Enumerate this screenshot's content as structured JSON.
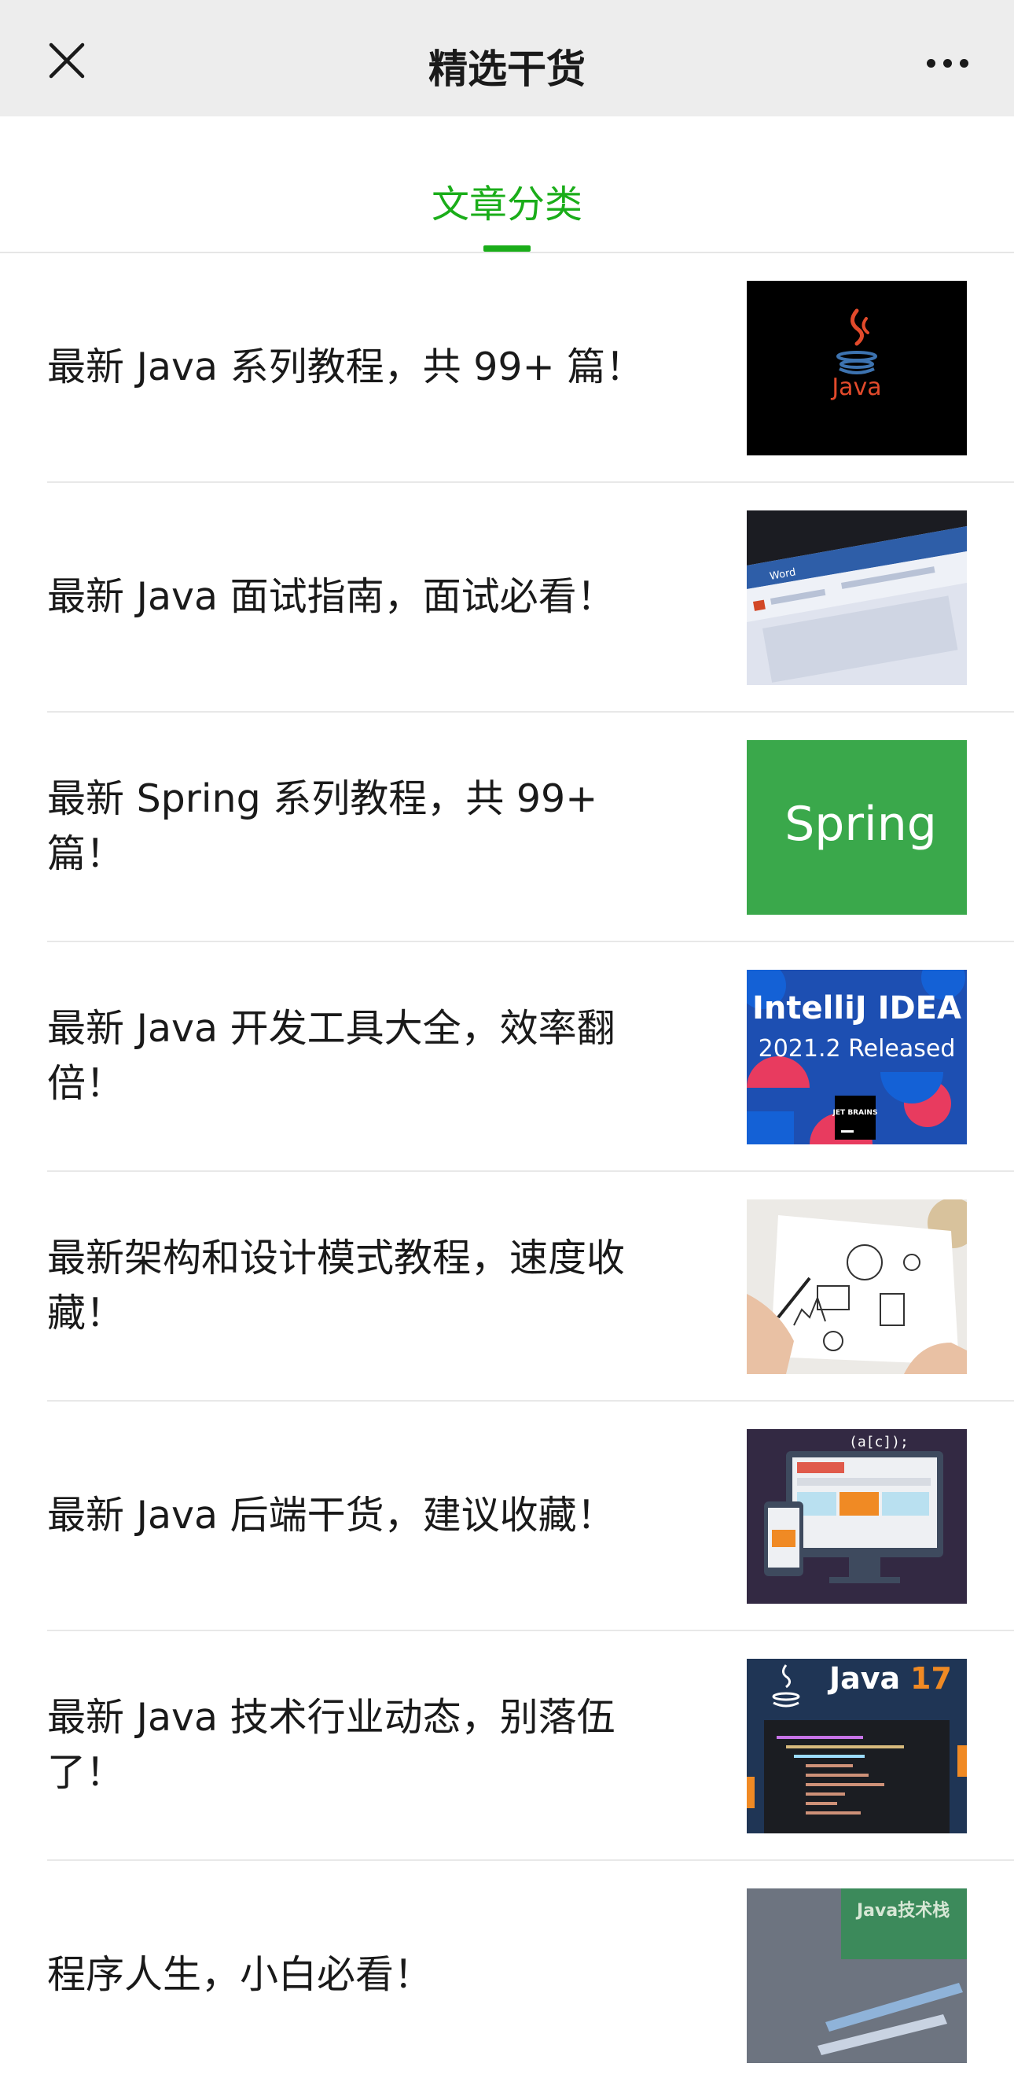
{
  "header": {
    "title": "精选干货",
    "close_icon": "close-icon",
    "more_icon": "more-dots-icon"
  },
  "tabs": [
    {
      "label": "文章分类",
      "active": true
    }
  ],
  "colors": {
    "accent": "#1aad19",
    "header_bg": "#ededed"
  },
  "articles": [
    {
      "title": "最新 Java 系列教程，共 99+ 篇！",
      "thumb_text": "Java"
    },
    {
      "title": "最新 Java 面试指南，面试必看！",
      "thumb_text": "Word"
    },
    {
      "title": "最新 Spring 系列教程，共 99+ 篇！",
      "thumb_text": "Spring"
    },
    {
      "title": "最新 Java 开发工具大全，效率翻倍！",
      "thumb_text": "IntelliJ IDEA",
      "thumb_subtext": "2021.2 Released",
      "thumb_badge": "JET BRAINS"
    },
    {
      "title": "最新架构和设计模式教程，速度收藏！",
      "thumb_text": ""
    },
    {
      "title": "最新 Java 后端干货，建议收藏！",
      "thumb_text": "(a[c]);"
    },
    {
      "title": "最新 Java 技术行业动态，别落伍了！",
      "thumb_text": "Java",
      "thumb_subtext": "17"
    },
    {
      "title": "程序人生，小白必看！",
      "thumb_text": "Java技术栈"
    }
  ]
}
